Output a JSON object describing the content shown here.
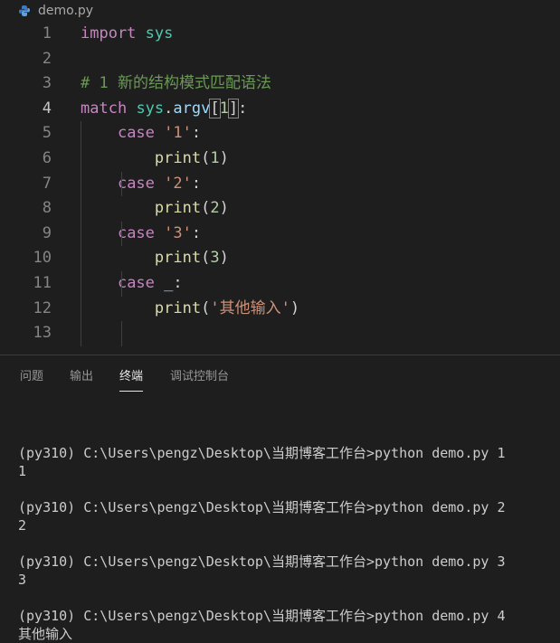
{
  "breadcrumb": {
    "file_name": "demo.py",
    "icon": "python-file-icon"
  },
  "editor": {
    "active_line": 4,
    "line_numbers": [
      "1",
      "2",
      "3",
      "4",
      "5",
      "6",
      "7",
      "8",
      "9",
      "10",
      "11",
      "12",
      "13"
    ],
    "lines": [
      [
        {
          "t": "import",
          "c": "kw-purple"
        },
        {
          "t": " ",
          "c": "plain"
        },
        {
          "t": "sys",
          "c": "mod"
        }
      ],
      [],
      [
        {
          "t": "# 1 新的结构模式匹配语法",
          "c": "cmt"
        }
      ],
      [
        {
          "t": "match",
          "c": "kw-purple"
        },
        {
          "t": " ",
          "c": "plain"
        },
        {
          "t": "sys",
          "c": "mod"
        },
        {
          "t": ".",
          "c": "plain"
        },
        {
          "t": "argv",
          "c": "var"
        },
        {
          "t": "[",
          "c": "plain",
          "box": true
        },
        {
          "t": "1",
          "c": "num"
        },
        {
          "t": "]",
          "c": "plain",
          "box": true
        },
        {
          "t": ":",
          "c": "plain"
        }
      ],
      [
        {
          "t": "    ",
          "c": "plain"
        },
        {
          "t": "case",
          "c": "kw-purple"
        },
        {
          "t": " ",
          "c": "plain"
        },
        {
          "t": "'1'",
          "c": "str"
        },
        {
          "t": ":",
          "c": "plain"
        }
      ],
      [
        {
          "t": "        ",
          "c": "plain"
        },
        {
          "t": "print",
          "c": "fn"
        },
        {
          "t": "(",
          "c": "plain"
        },
        {
          "t": "1",
          "c": "num"
        },
        {
          "t": ")",
          "c": "plain"
        }
      ],
      [
        {
          "t": "    ",
          "c": "plain"
        },
        {
          "t": "case",
          "c": "kw-purple"
        },
        {
          "t": " ",
          "c": "plain"
        },
        {
          "t": "'2'",
          "c": "str"
        },
        {
          "t": ":",
          "c": "plain"
        }
      ],
      [
        {
          "t": "        ",
          "c": "plain"
        },
        {
          "t": "print",
          "c": "fn"
        },
        {
          "t": "(",
          "c": "plain"
        },
        {
          "t": "2",
          "c": "num"
        },
        {
          "t": ")",
          "c": "plain"
        }
      ],
      [
        {
          "t": "    ",
          "c": "plain"
        },
        {
          "t": "case",
          "c": "kw-purple"
        },
        {
          "t": " ",
          "c": "plain"
        },
        {
          "t": "'3'",
          "c": "str"
        },
        {
          "t": ":",
          "c": "plain"
        }
      ],
      [
        {
          "t": "        ",
          "c": "plain"
        },
        {
          "t": "print",
          "c": "fn"
        },
        {
          "t": "(",
          "c": "plain"
        },
        {
          "t": "3",
          "c": "num"
        },
        {
          "t": ")",
          "c": "plain"
        }
      ],
      [
        {
          "t": "    ",
          "c": "plain"
        },
        {
          "t": "case",
          "c": "kw-purple"
        },
        {
          "t": " ",
          "c": "plain"
        },
        {
          "t": "_",
          "c": "var"
        },
        {
          "t": ":",
          "c": "plain"
        }
      ],
      [
        {
          "t": "        ",
          "c": "plain"
        },
        {
          "t": "print",
          "c": "fn"
        },
        {
          "t": "(",
          "c": "plain"
        },
        {
          "t": "'其他输入'",
          "c": "str"
        },
        {
          "t": ")",
          "c": "plain"
        }
      ],
      []
    ]
  },
  "panel": {
    "tabs": [
      {
        "label": "问题",
        "active": false
      },
      {
        "label": "输出",
        "active": false
      },
      {
        "label": "终端",
        "active": true
      },
      {
        "label": "调试控制台",
        "active": false
      }
    ],
    "terminal_lines": [
      "",
      "(py310) C:\\Users\\pengz\\Desktop\\当期博客工作台>python demo.py 1",
      "1",
      "",
      "(py310) C:\\Users\\pengz\\Desktop\\当期博客工作台>python demo.py 2",
      "2",
      "",
      "(py310) C:\\Users\\pengz\\Desktop\\当期博客工作台>python demo.py 3",
      "3",
      "",
      "(py310) C:\\Users\\pengz\\Desktop\\当期博客工作台>python demo.py 4",
      "其他输入"
    ]
  },
  "colors": {
    "background": "#1e1e1e",
    "keyword": "#c586c0",
    "module": "#4ec9b0",
    "function": "#dcdcaa",
    "string": "#ce9178",
    "number": "#b5cea8",
    "comment": "#6a9955"
  }
}
